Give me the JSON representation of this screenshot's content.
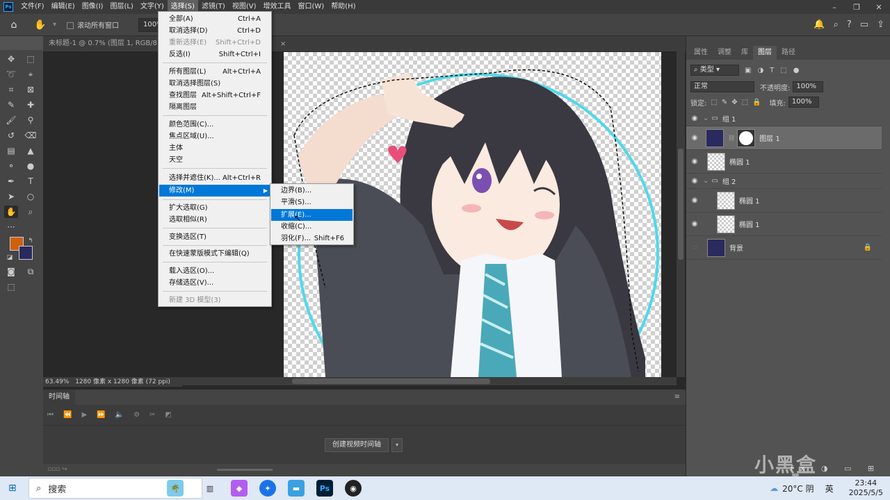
{
  "app": {
    "logo": "Ps",
    "title": "未标题-1 @ 0.7% (图层 1, RGB/8)"
  },
  "menubar": [
    "文件(F)",
    "编辑(E)",
    "图像(I)",
    "图层(L)",
    "文字(Y)",
    "选择(S)",
    "滤镜(T)",
    "视图(V)",
    "增效工具",
    "窗口(W)",
    "帮助(H)"
  ],
  "window_controls": [
    "–",
    "❐",
    "✕"
  ],
  "options": {
    "scroll_all_label": "滚动所有窗口",
    "zoom_value": "100%"
  },
  "doc_tab": {
    "title": "未标题-1 @ 0.7% (图层 1, RGB/8)",
    "close": "×"
  },
  "status": {
    "zoom": "63.49%",
    "info": "1280 像素 x 1280 像素 (72 ppi)"
  },
  "timeline": {
    "tab": "时间轴",
    "create_button": "创建视频时间轴",
    "dropdown_arrow": "▾"
  },
  "select_menu": {
    "items": [
      {
        "label": "全部(A)",
        "shortcut": "Ctrl+A"
      },
      {
        "label": "取消选择(D)",
        "shortcut": "Ctrl+D"
      },
      {
        "label": "重新选择(E)",
        "shortcut": "Shift+Ctrl+D"
      },
      {
        "label": "反选(I)",
        "shortcut": "Shift+Ctrl+I"
      },
      {
        "label": "所有图层(L)",
        "shortcut": "Alt+Ctrl+A"
      },
      {
        "label": "取消选择图层(S)",
        "shortcut": ""
      },
      {
        "label": "查找图层",
        "shortcut": "Alt+Shift+Ctrl+F"
      },
      {
        "label": "隔离图层",
        "shortcut": ""
      },
      {
        "label": "颜色范围(C)...",
        "shortcut": ""
      },
      {
        "label": "焦点区域(U)...",
        "shortcut": ""
      },
      {
        "label": "主体",
        "shortcut": ""
      },
      {
        "label": "天空",
        "shortcut": ""
      },
      {
        "label": "选择并遮住(K)...",
        "shortcut": "Alt+Ctrl+R"
      },
      {
        "label": "修改(M)",
        "shortcut": "▶"
      },
      {
        "label": "扩大选取(G)",
        "shortcut": ""
      },
      {
        "label": "选取相似(R)",
        "shortcut": ""
      },
      {
        "label": "变换选区(T)",
        "shortcut": ""
      },
      {
        "label": "在快速蒙版模式下编辑(Q)",
        "shortcut": ""
      },
      {
        "label": "载入选区(O)...",
        "shortcut": ""
      },
      {
        "label": "存储选区(V)...",
        "shortcut": ""
      },
      {
        "label": "新建 3D 模型(3)",
        "shortcut": ""
      }
    ]
  },
  "modify_submenu": {
    "items": [
      {
        "label": "边界(B)...",
        "shortcut": ""
      },
      {
        "label": "平滑(S)...",
        "shortcut": ""
      },
      {
        "label": "扩展(E)...",
        "shortcut": ""
      },
      {
        "label": "收缩(C)...",
        "shortcut": ""
      },
      {
        "label": "羽化(F)...",
        "shortcut": "Shift+F6"
      }
    ]
  },
  "panel": {
    "tabs": [
      "属性",
      "调整",
      "库",
      "图层",
      "路径"
    ],
    "active_tab": "图层",
    "filter_kind": "类型",
    "blend_mode": "正常",
    "opacity_label": "不透明度:",
    "opacity_value": "100%",
    "lock_label": "锁定:",
    "fill_label": "填充:",
    "fill_value": "100%",
    "layers": [
      {
        "name": "组 1",
        "type": "group",
        "visible": true
      },
      {
        "name": "图层 1",
        "type": "layer-mask",
        "visible": true,
        "selected": true
      },
      {
        "name": "椭圆 1",
        "type": "shape",
        "visible": true
      },
      {
        "name": "组 2",
        "type": "group",
        "visible": true
      },
      {
        "name": "椭圆 1",
        "type": "shape",
        "visible": true
      },
      {
        "name": "椭圆 1",
        "type": "shape",
        "visible": true
      },
      {
        "name": "背景",
        "type": "background",
        "visible": false,
        "locked": true
      }
    ]
  },
  "colors": {
    "foreground": "#d0600e",
    "background": "#2a2a5e",
    "menu_highlight": "#0078d7",
    "ring": "#4fd9ea"
  },
  "taskbar": {
    "search_placeholder": "搜索",
    "weather": "20°C 阴",
    "ime": "英",
    "time": "23:44",
    "date": "2025/5/5",
    "ps_label": "Ps"
  },
  "watermark": "小黑盒"
}
